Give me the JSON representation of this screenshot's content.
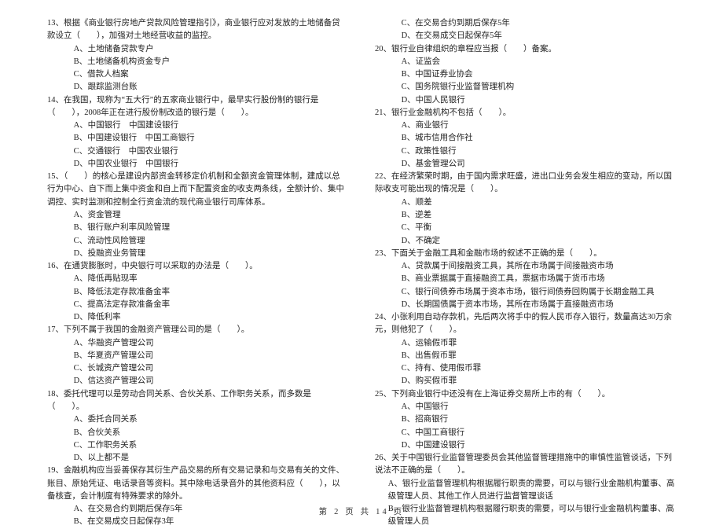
{
  "footer": "第 2 页 共 14 页",
  "left": {
    "q13": {
      "stem": "13、根据《商业银行房地产贷款风险管理指引》，商业银行应对发放的土地储备贷款设立（　　），加强对土地经营收益的监控。",
      "A": "A、土地储备贷款专户",
      "B": "B、土地储备机构资金专户",
      "C": "C、借款人档案",
      "D": "D、跟踪监测台账"
    },
    "q14": {
      "stem": "14、在我国，现称为“五大行”的五家商业银行中，最早实行股份制的银行是（　　），2008年正在进行股份制改造的银行是（　　）。",
      "A": "A、中国银行　中国建设银行",
      "B": "B、中国建设银行　中国工商银行",
      "C": "C、交通银行　中国农业银行",
      "D": "D、中国农业银行　中国银行"
    },
    "q15": {
      "stem": "15、（　　）的核心是建设内部资金转移定价机制和全额资金管理体制，建成以总行为中心、自下而上集中资金和自上而下配置资金的收支两条线，全额计价、集中调控、实时监测和控制全行资金流的现代商业银行司库体系。",
      "A": "A、资金管理",
      "B": "B、银行账户利率风险管理",
      "C": "C、流动性风险管理",
      "D": "D、投融资业务管理"
    },
    "q16": {
      "stem": "16、在通货膨胀时，中央银行可以采取的办法是（　　）。",
      "A": "A、降低再贴现率",
      "B": "B、降低法定存款准备金率",
      "C": "C、提高法定存款准备金率",
      "D": "D、降低利率"
    },
    "q17": {
      "stem": "17、下列不属于我国的金融资产管理公司的是（　　）。",
      "A": "A、华融资产管理公司",
      "B": "B、华夏资产管理公司",
      "C": "C、长城资产管理公司",
      "D": "D、信达资产管理公司"
    },
    "q18": {
      "stem": "18、委托代理可以是劳动合同关系、合伙关系、工作职务关系，而多数是（　　）。",
      "A": "A、委托合同关系",
      "B": "B、合伙关系",
      "C": "C、工作职务关系",
      "D": "D、以上都不是"
    },
    "q19": {
      "stem": "19、金融机构应当妥善保存其衍生产品交易的所有交易记录和与交易有关的文件、账目、原始凭证、电话录音等资料。其中除电话录音外的其他资料应（　　），以备核查，会计制度有特殊要求的除外。",
      "A": "A、在交易合约到期后保存5年",
      "B": "B、在交易成交日起保存3年"
    }
  },
  "right": {
    "q19": {
      "C": "C、在交易合约到期后保存5年",
      "D": "D、在交易成交日起保存5年"
    },
    "q20": {
      "stem": "20、银行业自律组织的章程应当报（　　）备案。",
      "A": "A、证监会",
      "B": "B、中国证券业协会",
      "C": "C、国务院银行业监督管理机构",
      "D": "D、中国人民银行"
    },
    "q21": {
      "stem": "21、银行业金融机构不包括（　　）。",
      "A": "A、商业银行",
      "B": "B、城市信用合作社",
      "C": "C、政策性银行",
      "D": "D、基金管理公司"
    },
    "q22": {
      "stem": "22、在经济繁荣时期，由于国内需求旺盛，进出口业务会发生相应的变动，所以国际收支可能出现的情况是（　　）。",
      "A": "A、顺差",
      "B": "B、逆差",
      "C": "C、平衡",
      "D": "D、不确定"
    },
    "q23": {
      "stem": "23、下面关于金融工具和金融市场的叙述不正确的是（　　）。",
      "A": "A、贷款属于间接融资工具，其所在市场属于间接融资市场",
      "B": "B、商业票据属于直接融资工具，票据市场属于货币市场",
      "C": "C、银行间债券市场属于资本市场，银行间债券回购属于长期金融工具",
      "D": "D、长期国债属于资本市场，其所在市场属于直接融资市场"
    },
    "q24": {
      "stem": "24、小张利用自动存款机，先后两次将手中的假人民币存入银行，数量高达30万余元，则他犯了（　　）。",
      "A": "A、运输假币罪",
      "B": "B、出售假币罪",
      "C": "C、持有、使用假币罪",
      "D": "D、购买假币罪"
    },
    "q25": {
      "stem": "25、下列商业银行中还没有在上海证券交易所上市的有（　　）。",
      "A": "A、中国银行",
      "B": "B、招商银行",
      "C": "C、中国工商银行",
      "D": "D、中国建设银行"
    },
    "q26": {
      "stem": "26、关于中国银行业监督管理委员会其他监督管理措施中的审慎性监管谈话，下列说法不正确的是（　　）。",
      "A": "A、银行业监督管理机构根据履行职责的需要，可以与银行业金融机构董事、高级管理人员、其他工作人员进行监督管理谈话",
      "B": "B、银行业监督管理机构根据履行职责的需要，可以与银行业金融机构董事、高级管理人员"
    }
  }
}
